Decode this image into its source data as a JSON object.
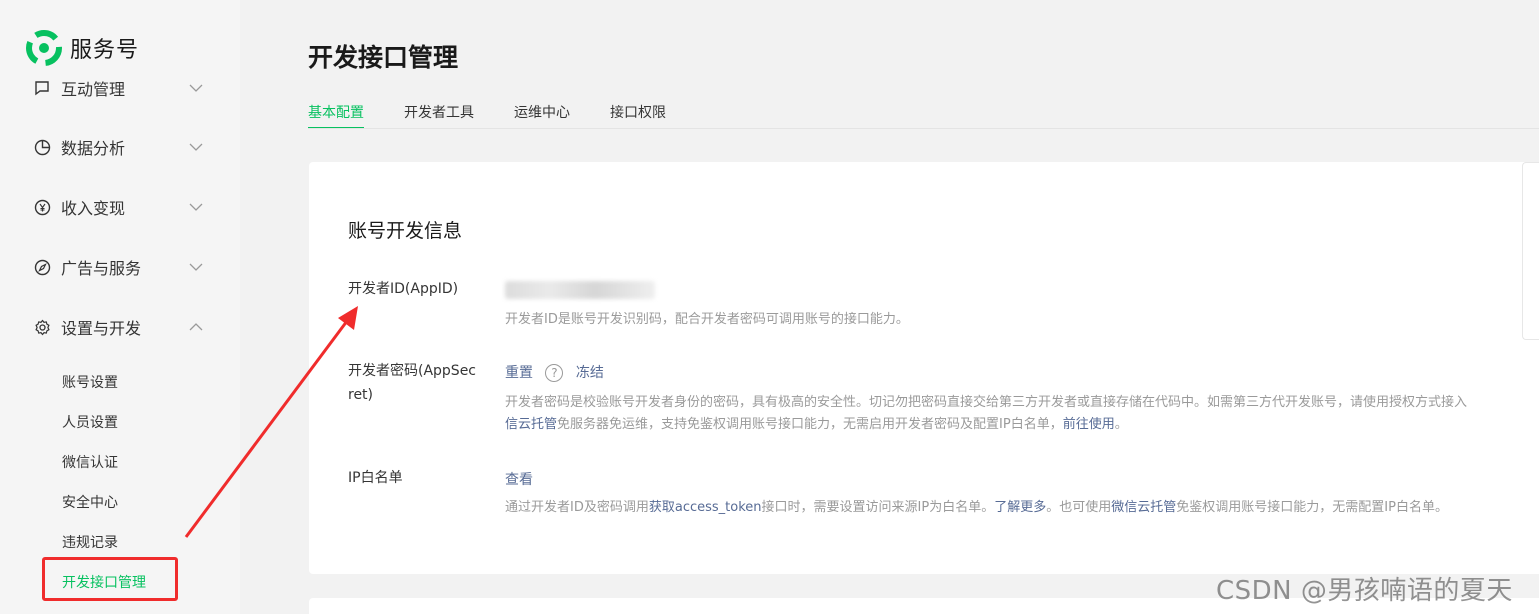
{
  "brand": {
    "name": "服务号",
    "accent": "#07c160"
  },
  "sidebar": {
    "groups": [
      {
        "label": "互动管理",
        "icon": "message-icon",
        "expanded": false
      },
      {
        "label": "数据分析",
        "icon": "pie-chart-icon",
        "expanded": false
      },
      {
        "label": "收入变现",
        "icon": "yen-icon",
        "expanded": false
      },
      {
        "label": "广告与服务",
        "icon": "compass-icon",
        "expanded": false
      },
      {
        "label": "设置与开发",
        "icon": "gear-icon",
        "expanded": true
      }
    ],
    "sub_items": [
      {
        "label": "账号设置"
      },
      {
        "label": "人员设置"
      },
      {
        "label": "微信认证"
      },
      {
        "label": "安全中心"
      },
      {
        "label": "违规记录"
      },
      {
        "label": "开发接口管理",
        "active": true
      }
    ]
  },
  "main": {
    "title": "开发接口管理",
    "tabs": [
      {
        "label": "基本配置",
        "active": true
      },
      {
        "label": "开发者工具"
      },
      {
        "label": "运维中心"
      },
      {
        "label": "接口权限"
      }
    ],
    "section_title": "账号开发信息",
    "appid": {
      "label": "开发者ID(AppID)",
      "desc": "开发者ID是账号开发识别码，配合开发者密码可调用账号的接口能力。"
    },
    "appsecret": {
      "label": "开发者密码(AppSecret)",
      "reset": "重置",
      "help": "?",
      "freeze": "冻结",
      "desc1": "开发者密码是校验账号开发者身份的密码，具有极高的安全性。切记勿把密码直接交给第三方开发者或直接存储在代码中。如需第三方代开发账号，请使用授权方式接入",
      "desc2_link1": "信云托管",
      "desc2_mid": "免服务器免运维，支持免鉴权调用账号接口能力，无需启用开发者密码及配置IP白名单，",
      "desc2_link2": "前往使用",
      "desc2_end": "。"
    },
    "ip_whitelist": {
      "label": "IP白名单",
      "view": "查看",
      "desc_a": "通过开发者ID及密码调用",
      "desc_link1": "获取access_token",
      "desc_b": "接口时，需要设置访问来源IP为白名单。",
      "desc_link2": "了解更多",
      "desc_c": "。也可使用",
      "desc_link3": "微信云托管",
      "desc_d": "免鉴权调用账号接口能力，无需配置IP白名单。"
    }
  },
  "watermark": "CSDN @男孩喃语的夏天",
  "colors": {
    "link": "#576b95",
    "annotation": "#f02c2c",
    "muted": "#9a9a9a"
  }
}
